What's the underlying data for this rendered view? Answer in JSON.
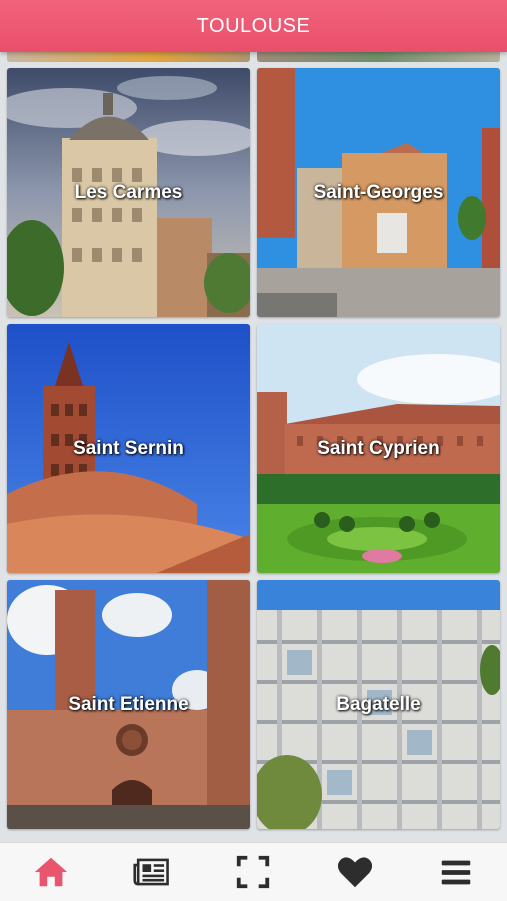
{
  "header": {
    "title": "TOULOUSE"
  },
  "neighborhoods": [
    {
      "label": "Les Carmes"
    },
    {
      "label": "Saint-Georges"
    },
    {
      "label": "Saint Sernin"
    },
    {
      "label": "Saint Cyprien"
    },
    {
      "label": "Saint Etienne"
    },
    {
      "label": "Bagatelle"
    }
  ],
  "nav": {
    "icons": [
      "home-icon",
      "newspaper-icon",
      "scan-icon",
      "heart-icon",
      "menu-icon"
    ],
    "active_color": "#e9556d",
    "inactive_color": "#2d2d2d"
  },
  "colors": {
    "header": "#ee5a73",
    "background": "#dfe3e6"
  }
}
